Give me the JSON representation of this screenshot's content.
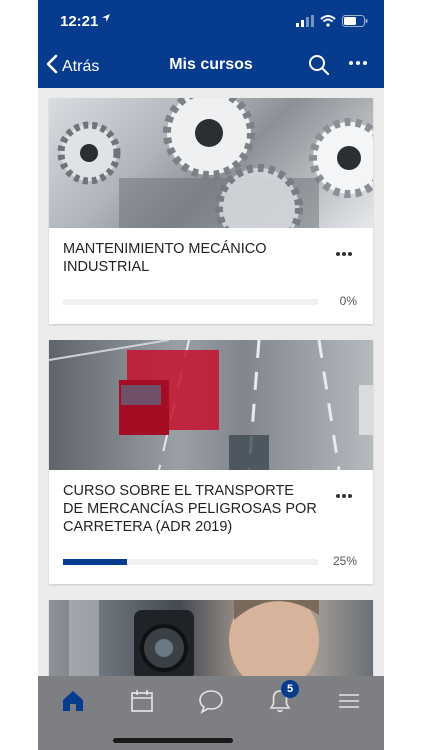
{
  "status": {
    "time": "12:21",
    "location_icon": "location-arrow-icon"
  },
  "nav": {
    "back_label": "Atrás",
    "title": "Mis cursos"
  },
  "courses": [
    {
      "title": "MANTENIMIENTO MECÁNICO INDUSTRIAL",
      "progress_label": "0%",
      "progress": 0,
      "image": "gears"
    },
    {
      "title": "CURSO SOBRE EL TRANSPORTE DE MERCANCÍAS PELIGROSAS POR CARRETERA (ADR 2019)",
      "progress_label": "25%",
      "progress": 0.25,
      "image": "truck-on-highway"
    },
    {
      "title": "",
      "image": "man-with-camera"
    }
  ],
  "tabbar": {
    "notifications_badge": "5"
  },
  "colors": {
    "brand": "#063b8e",
    "tabbar": "#7e7f83",
    "background": "#ececec"
  }
}
